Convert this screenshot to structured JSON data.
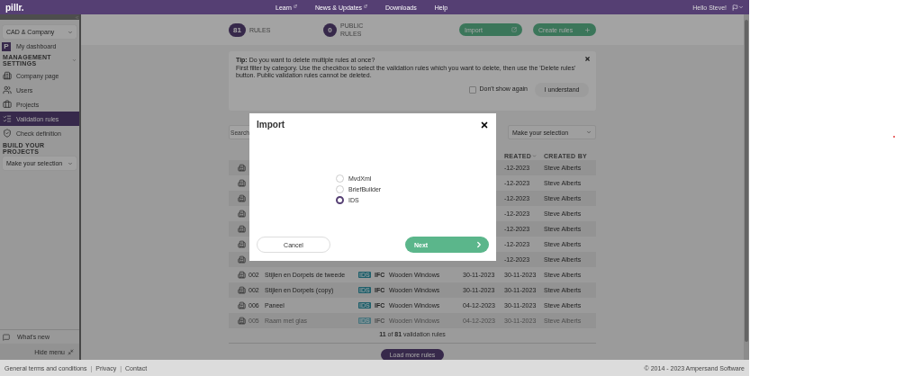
{
  "top_bar": {
    "logo": "pillr.",
    "nav": [
      {
        "label": "Learn",
        "external": true
      },
      {
        "label": "News & Updates",
        "external": true
      },
      {
        "label": "Downloads",
        "external": false
      },
      {
        "label": "Help",
        "external": false
      }
    ],
    "greeting": "Hello Steve!"
  },
  "sidebar": {
    "company": "CAD & Company",
    "dashboard_logo": "P",
    "dashboard": "My dashboard",
    "sections": [
      {
        "title": "MANAGEMENT SETTINGS",
        "expanded": true,
        "items": [
          {
            "label": "Company page",
            "kind": "company",
            "selected": false
          },
          {
            "label": "Users",
            "kind": "users",
            "selected": false
          },
          {
            "label": "Projects",
            "kind": "projects",
            "selected": false
          },
          {
            "label": "Validation rules",
            "kind": "rules",
            "selected": true
          },
          {
            "label": "Check definition",
            "kind": "check",
            "selected": false
          }
        ]
      },
      {
        "title": "BUILD YOUR PROJECTS",
        "select": "Make your selection"
      }
    ],
    "whats_new": "What's new",
    "hide_menu": "Hide menu"
  },
  "stats": [
    {
      "value": "81",
      "label": "RULES"
    },
    {
      "value": "0",
      "label": "PUBLIC RULES"
    }
  ],
  "actions": [
    {
      "label": "Import",
      "kind": "import"
    },
    {
      "label": "Create rules",
      "kind": "create"
    }
  ],
  "tip": {
    "lines": [
      "**Tip:** Do you want to delete multiple rules at once?",
      "First filter by category. Use the checkbox to select the validation rules which you want to delete, then use the 'Delete rules' button. Public validation rules cannot be deleted."
    ],
    "checkbox": {
      "label": "Don't show again",
      "checked": false
    },
    "button": "I understand"
  },
  "filters": {
    "search_placeholder": "Search",
    "category_select": "Make your selection"
  },
  "table": {
    "columns": [
      {
        "label": "REATED",
        "sorted": true
      },
      {
        "label": "CREATED BY",
        "sorted": false
      }
    ],
    "rows": [
      {
        "created": "-12-2023",
        "created_by": "Steve Alberts"
      },
      {
        "created": "-12-2023",
        "created_by": "Steve Alberts"
      },
      {
        "created": "-12-2023",
        "created_by": "Steve Alberts"
      },
      {
        "created": "-12-2023",
        "created_by": "Steve Alberts"
      },
      {
        "created": "-12-2023",
        "created_by": "Steve Alberts"
      },
      {
        "created": "-12-2023",
        "created_by": "Steve Alberts"
      },
      {
        "created": "-12-2023",
        "created_by": "Steve Alberts"
      },
      {
        "id": "002",
        "name": "Stijlen en Dorpels de tweede",
        "tag": "IDS",
        "format": "IFC",
        "category": "Wooden Windows",
        "date": "30-11-2023",
        "created": "30-11-2023",
        "created_by": "Steve Alberts",
        "faded": false
      },
      {
        "id": "002",
        "name": "Stijlen en Dorpels (copy)",
        "tag": "IDS",
        "format": "IFC",
        "category": "Wooden Windows",
        "date": "30-11-2023",
        "created": "30-11-2023",
        "created_by": "Steve Alberts",
        "faded": false
      },
      {
        "id": "006",
        "name": "Paneel",
        "tag": "IDS",
        "format": "IFC",
        "category": "Wooden Windows",
        "date": "04-12-2023",
        "created": "30-11-2023",
        "created_by": "Steve Alberts",
        "faded": false
      },
      {
        "id": "005",
        "name": "Raam met glas",
        "tag": "IDS",
        "format": "IFC",
        "category": "Wooden Windows",
        "date": "04-12-2023",
        "created": "30-11-2023",
        "created_by": "Steve Alberts",
        "faded": true
      }
    ]
  },
  "count": "**11** of **81** validation rules",
  "load_more": "Load more rules",
  "modal": {
    "title": "Import",
    "options": [
      {
        "label": "MvdXml",
        "selected": false
      },
      {
        "label": "BriefBuilder",
        "selected": false
      },
      {
        "label": "IDS",
        "selected": true
      }
    ],
    "cancel": "Cancel",
    "next": "Next"
  },
  "footer": {
    "links": [
      "General terms and conditions",
      "Privacy",
      "Contact"
    ],
    "separator": "|",
    "copyright": "© 2014 - 2023 Ampersand Software"
  }
}
